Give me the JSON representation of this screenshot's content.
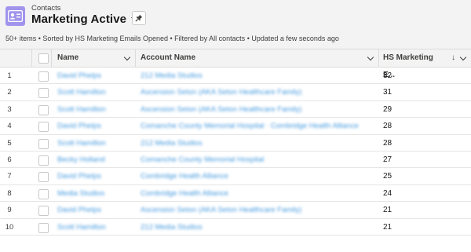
{
  "header": {
    "object_label": "Contacts",
    "list_title": "Marketing Active",
    "meta": "50+ items • Sorted by HS Marketing Emails Opened • Filtered by All contacts • Updated a few seconds ago"
  },
  "columns": {
    "name": "Name",
    "account": "Account Name",
    "emails": "HS Marketing E..."
  },
  "rows": [
    {
      "num": "1",
      "name": "David Phelps",
      "account": "212 Media Studios",
      "emails": "32"
    },
    {
      "num": "2",
      "name": "Scott Hamilton",
      "account": "Ascension Seton (AKA Seton Healthcare Family)",
      "emails": "31"
    },
    {
      "num": "3",
      "name": "Scott Hamilton",
      "account": "Ascension Seton (AKA Seton Healthcare Family)",
      "emails": "29"
    },
    {
      "num": "4",
      "name": "David Phelps",
      "account": "Comanche County Memorial Hospital · Combridge Health Alliance",
      "emails": "28"
    },
    {
      "num": "5",
      "name": "Scott Hamilton",
      "account": "212 Media Studios",
      "emails": "28"
    },
    {
      "num": "6",
      "name": "Becky Holland",
      "account": "Comanche County Memorial Hospital",
      "emails": "27"
    },
    {
      "num": "7",
      "name": "David Phelps",
      "account": "Combridge Health Alliance",
      "emails": "25"
    },
    {
      "num": "8",
      "name": "Media Studios",
      "account": "Combridge Health Alliance",
      "emails": "24"
    },
    {
      "num": "9",
      "name": "David Phelps",
      "account": "Ascension Seton (AKA Seton Healthcare Family)",
      "emails": "21"
    },
    {
      "num": "10",
      "name": "Scott Hamilton",
      "account": "212 Media Studios",
      "emails": "21"
    }
  ],
  "colors": {
    "icon_bg": "#a094ed",
    "header_bg": "#f3f3f3",
    "link": "#0176d3"
  },
  "icons": {
    "object": "contact-card-icon",
    "pin": "pin-icon",
    "sort": "arrow-down-icon"
  }
}
